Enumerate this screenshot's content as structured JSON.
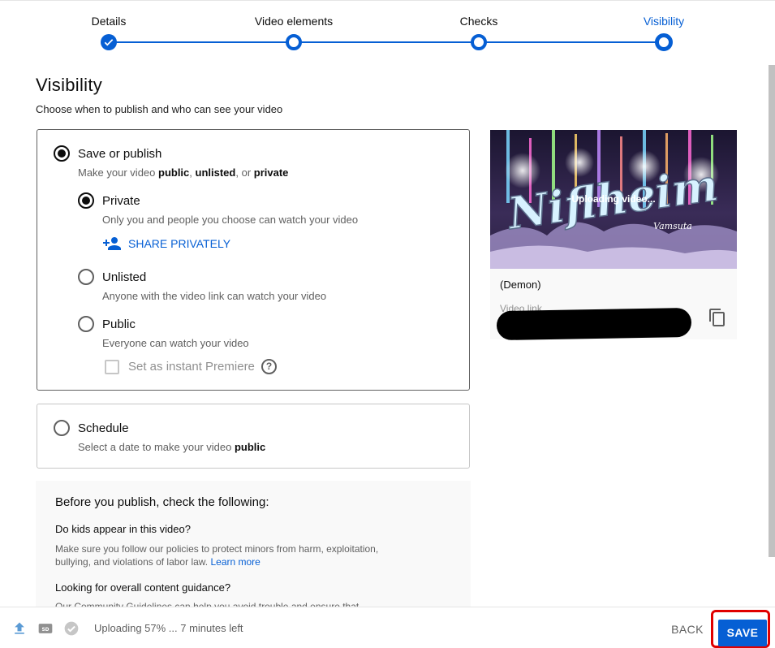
{
  "stepper": {
    "steps": [
      {
        "label": "Details",
        "state": "done"
      },
      {
        "label": "Video elements",
        "state": "done"
      },
      {
        "label": "Checks",
        "state": "done"
      },
      {
        "label": "Visibility",
        "state": "current"
      }
    ]
  },
  "page": {
    "title": "Visibility",
    "subtitle": "Choose when to publish and who can see your video"
  },
  "save_or_publish": {
    "label": "Save or publish",
    "desc_prefix": "Make your video ",
    "desc_public": "public",
    "desc_sep1": ", ",
    "desc_unlisted": "unlisted",
    "desc_sep2": ", or ",
    "desc_private": "private",
    "selected": true,
    "options": {
      "private": {
        "label": "Private",
        "desc": "Only you and people you choose can watch your video",
        "selected": true
      },
      "share": {
        "label": "SHARE PRIVATELY"
      },
      "unlisted": {
        "label": "Unlisted",
        "desc": "Anyone with the video link can watch your video",
        "selected": false
      },
      "public": {
        "label": "Public",
        "desc": "Everyone can watch your video",
        "selected": false
      },
      "premiere": {
        "label": "Set as instant Premiere",
        "checked": false,
        "help": "?"
      }
    }
  },
  "schedule": {
    "label": "Schedule",
    "desc_prefix": "Select a date to make your video ",
    "desc_bold": "public",
    "selected": false
  },
  "checklist": {
    "title": "Before you publish, check the following:",
    "q1": "Do kids appear in this video?",
    "p1": "Make sure you follow our policies to protect minors from harm, exploitation, bullying, and violations of labor law.",
    "p1_link": "Learn more",
    "q2": "Looking for overall content guidance?",
    "p2": "Our Community Guidelines can help you avoid trouble and ensure that"
  },
  "preview": {
    "thumbnail_text": "Niflheim",
    "thumbnail_subtext": "Vamsuta",
    "status": "Uploading video...",
    "video_title": "(Demon)",
    "link_label": "Video link"
  },
  "footer": {
    "upload_status": "Uploading 57% ... 7 minutes left",
    "upload_progress": 0.57,
    "back_label": "BACK",
    "save_label": "SAVE"
  },
  "colors": {
    "accent": "#065fd4",
    "highlight": "#e00000"
  }
}
